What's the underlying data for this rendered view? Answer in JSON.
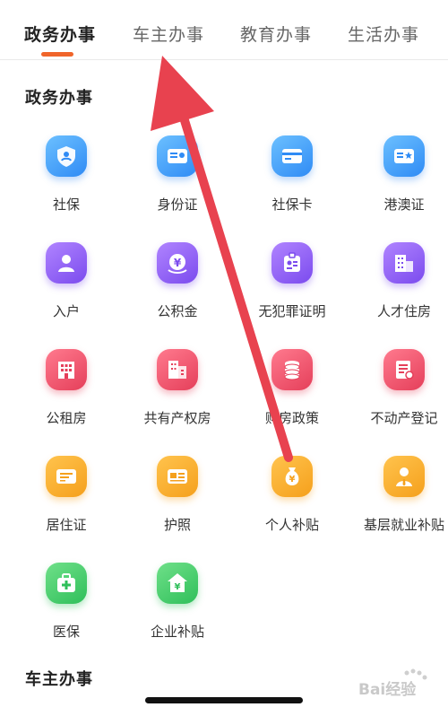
{
  "tabs": [
    {
      "label": "政务办事",
      "active": true
    },
    {
      "label": "车主办事",
      "active": false
    },
    {
      "label": "教育办事",
      "active": false
    },
    {
      "label": "生活办事",
      "active": false
    }
  ],
  "sections": [
    {
      "title": "政务办事"
    },
    {
      "title": "车主办事"
    }
  ],
  "items": [
    {
      "label": "社保",
      "icon": "shield-person-icon",
      "color": "blue"
    },
    {
      "label": "身份证",
      "icon": "id-card-icon",
      "color": "blue"
    },
    {
      "label": "社保卡",
      "icon": "card-icon",
      "color": "blue"
    },
    {
      "label": "港澳证",
      "icon": "passport-star-icon",
      "color": "blue"
    },
    {
      "label": "入户",
      "icon": "person-icon",
      "color": "purple"
    },
    {
      "label": "公积金",
      "icon": "yuan-coin-icon",
      "color": "purple"
    },
    {
      "label": "无犯罪证明",
      "icon": "badge-icon",
      "color": "purple"
    },
    {
      "label": "人才住房",
      "icon": "building-icon",
      "color": "purple"
    },
    {
      "label": "公租房",
      "icon": "apartment-icon",
      "color": "red"
    },
    {
      "label": "共有产权房",
      "icon": "buildings-icon",
      "color": "red"
    },
    {
      "label": "购房政策",
      "icon": "coin-stack-icon",
      "color": "red"
    },
    {
      "label": "不动产登记",
      "icon": "document-icon",
      "color": "red"
    },
    {
      "label": "居住证",
      "icon": "certificate-icon",
      "color": "orange"
    },
    {
      "label": "护照",
      "icon": "passport-icon",
      "color": "orange"
    },
    {
      "label": "个人补贴",
      "icon": "money-bag-icon",
      "color": "orange"
    },
    {
      "label": "基层就业补贴",
      "icon": "worker-icon",
      "color": "orange"
    },
    {
      "label": "医保",
      "icon": "medical-kit-icon",
      "color": "green"
    },
    {
      "label": "企业补贴",
      "icon": "house-yuan-icon",
      "color": "green"
    }
  ],
  "watermark": {
    "text": "Bai经验"
  },
  "colors": {
    "accent": "#f0652a",
    "arrow": "#e8424f"
  }
}
